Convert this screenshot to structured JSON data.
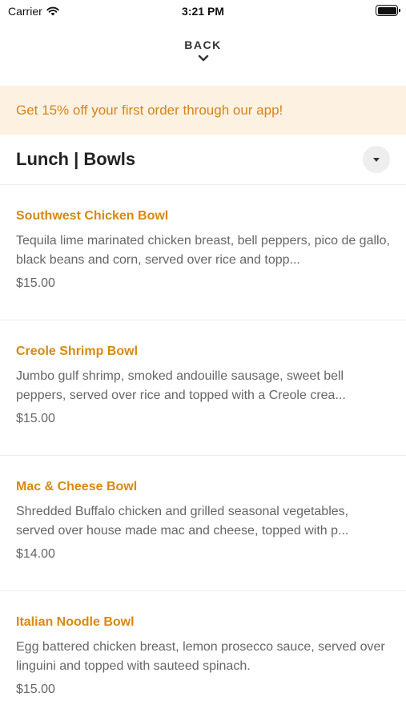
{
  "status_bar": {
    "carrier": "Carrier",
    "time": "3:21 PM"
  },
  "nav": {
    "back_label": "BACK"
  },
  "promo": {
    "text": "Get 15% off your first order through our app!"
  },
  "section": {
    "title": "Lunch | Bowls"
  },
  "items": [
    {
      "name": "Southwest Chicken Bowl",
      "description": "Tequila lime marinated chicken breast, bell peppers, pico de gallo, black beans and corn, served over rice and topp...",
      "price": "$15.00"
    },
    {
      "name": "Creole Shrimp Bowl",
      "description": "Jumbo gulf shrimp, smoked andouille sausage, sweet bell peppers, served over rice and topped with a Creole crea...",
      "price": "$15.00"
    },
    {
      "name": "Mac & Cheese Bowl",
      "description": "Shredded Buffalo chicken and grilled seasonal vegetables, served over house made mac and cheese, topped with p...",
      "price": "$14.00"
    },
    {
      "name": "Italian Noodle Bowl",
      "description": "Egg battered chicken breast, lemon prosecco sauce, served over linguini and topped with sauteed spinach.",
      "price": "$15.00"
    }
  ],
  "colors": {
    "accent": "#d9880f",
    "promo_bg": "#fdf2e1",
    "promo_text": "#d9821a"
  }
}
